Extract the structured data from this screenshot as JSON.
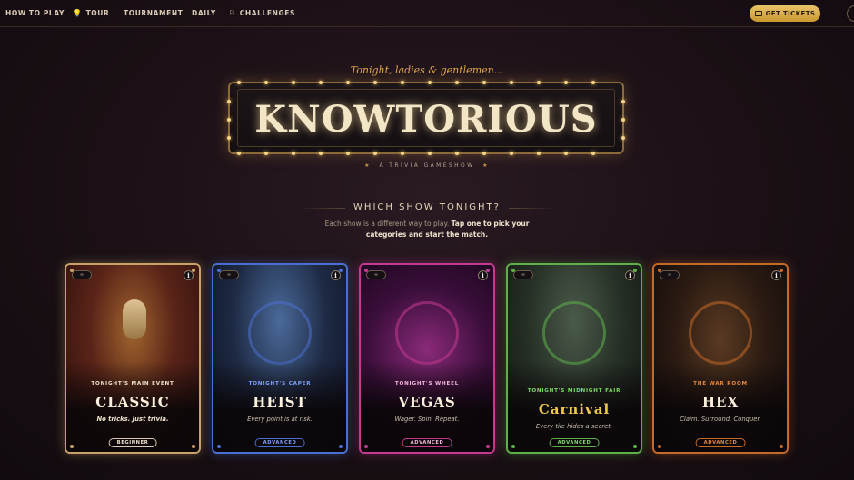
{
  "nav": {
    "items": [
      {
        "label": "HOW TO PLAY",
        "icon": ""
      },
      {
        "label": "TOUR",
        "icon": "lightbulb-icon"
      },
      {
        "label": "TOURNAMENT",
        "icon": ""
      },
      {
        "label": "DAILY",
        "icon": ""
      },
      {
        "label": "CHALLENGES",
        "icon": "flag-icon"
      }
    ],
    "cta_label": "GET TICKETS"
  },
  "hero": {
    "tagline": "Tonight, ladies & gentlemen...",
    "title": "KNOWTORIOUS",
    "subtitle": "A TRIVIA GAMESHOW"
  },
  "picker": {
    "heading": "WHICH SHOW TONIGHT?",
    "intro_plain": "Each show is a different way to play.",
    "intro_bold": "Tap one to pick your categories and start the match."
  },
  "cards": [
    {
      "chip": "∞",
      "eyebrow": "TONIGHT'S MAIN EVENT",
      "name": "CLASSIC",
      "desc": "No tricks. Just trivia.",
      "level": "BEGINNER",
      "accent": "#c9a26a",
      "eyebrow_color": "#f0e4cc"
    },
    {
      "chip": "∞",
      "eyebrow": "TONIGHT'S CAPER",
      "name": "HEIST",
      "desc": "Every point is at risk.",
      "level": "ADVANCED",
      "accent": "#4a6fd0",
      "eyebrow_color": "#7fa2ff"
    },
    {
      "chip": "∞",
      "eyebrow": "TONIGHT'S WHEEL",
      "name": "VEGAS",
      "desc": "Wager. Spin. Repeat.",
      "level": "ADVANCED",
      "accent": "#c43a8f",
      "eyebrow_color": "#f2b8dc"
    },
    {
      "chip": "∞",
      "eyebrow": "TONIGHT'S MIDNIGHT FAIR",
      "name": "Carnival",
      "desc": "Every tile hides a secret.",
      "level": "ADVANCED",
      "accent": "#5fb04a",
      "eyebrow_color": "#7fdc6a"
    },
    {
      "chip": "∞",
      "eyebrow": "THE WAR ROOM",
      "name": "HEX",
      "desc": "Claim. Surround. Conquer.",
      "level": "ADVANCED",
      "accent": "#c66a28",
      "eyebrow_color": "#e88a3a"
    }
  ],
  "colors": {
    "gold": "#e2a94a",
    "background": "#1a1015"
  }
}
